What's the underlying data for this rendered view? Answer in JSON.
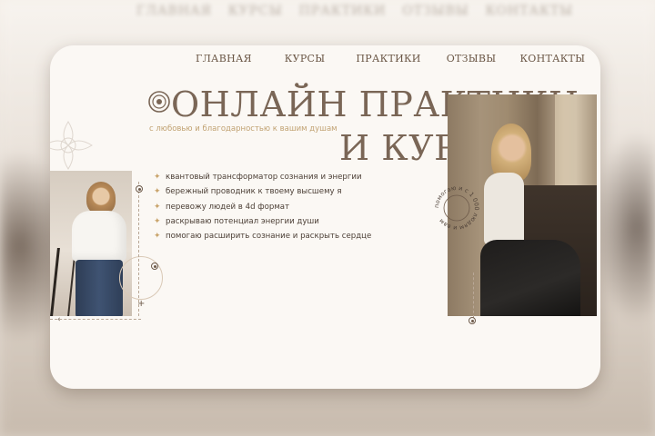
{
  "background_nav": [
    "ГЛАВНАЯ",
    "КУРСЫ",
    "ПРАКТИКИ",
    "ОТЗЫВЫ",
    "КОНТАКТЫ"
  ],
  "nav": {
    "items": [
      {
        "label": "ГЛАВНАЯ"
      },
      {
        "label": "КУРСЫ"
      },
      {
        "label": "ПРАКТИКИ"
      },
      {
        "label": "ОТЗЫВЫ"
      },
      {
        "label": "КОНТАКТЫ"
      }
    ]
  },
  "hero": {
    "title_line1": "ОНЛАЙН ПРАКТИКИ",
    "title_line2": "И КУРСЫ",
    "subtitle": "с любовью и благодарностью к вашим душам",
    "bullets": [
      "квантовый трансформатор сознания и энергии",
      "бережный проводник к твоему высшему я",
      "перевожу людей в 4d формат",
      "раскрываю потенциал энергии души",
      "помогаю расширить сознание и раскрыть сердце"
    ],
    "badge_text": "помогаю и с 1 000 людям и вам"
  },
  "colors": {
    "accent_gold": "#c9a46b",
    "title_brown": "#7a6656",
    "card_bg": "#fbf8f4"
  },
  "icons": {
    "bullet": "star-icon",
    "decor": "mandala-icon"
  }
}
